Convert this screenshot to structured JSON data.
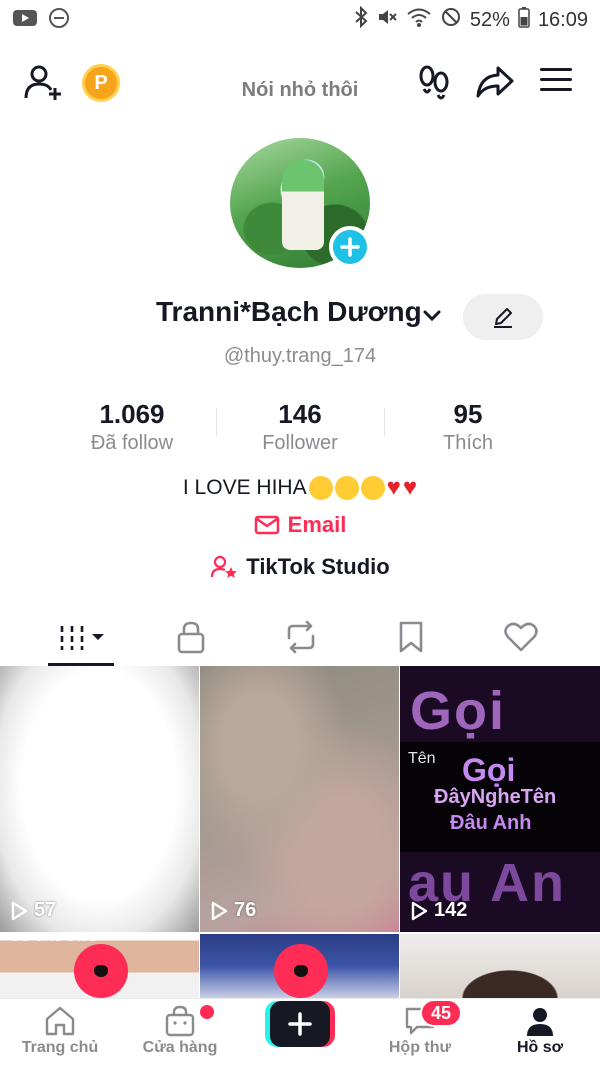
{
  "status_bar": {
    "battery_percent": "52%",
    "time": "16:09"
  },
  "header": {
    "coin_label": "P",
    "note": "Nói nhỏ thôi"
  },
  "profile": {
    "display_name": "Tranni*Bạch Dương",
    "username": "@thuy.trang_174",
    "bio_text": "I LOVE HIHA",
    "email_label": "Email",
    "studio_label": "TikTok Studio"
  },
  "stats": [
    {
      "value": "1.069",
      "label": "Đã follow"
    },
    {
      "value": "146",
      "label": "Follower"
    },
    {
      "value": "95",
      "label": "Thích"
    }
  ],
  "tabs": [
    {
      "icon": "grid-icon",
      "active": true
    },
    {
      "icon": "lock-icon",
      "active": false
    },
    {
      "icon": "repost-icon",
      "active": false
    },
    {
      "icon": "bookmark-icon",
      "active": false
    },
    {
      "icon": "heart-icon",
      "active": false
    }
  ],
  "videos": [
    {
      "views": "57"
    },
    {
      "views": "76"
    },
    {
      "views": "142",
      "cover_text": {
        "top": "Gọi",
        "label": "Tên",
        "title": "Gọi",
        "line2": "ĐâyNgheTên",
        "line3": "Đâu Anh",
        "bottom": "au An"
      }
    },
    {
      "cover_text": "CÔ TRƯỜNG"
    },
    {},
    {}
  ],
  "bottom_nav": {
    "home": "Trang chủ",
    "shop": "Cửa hàng",
    "inbox": "Hộp thư",
    "inbox_badge": "45",
    "profile": "Hồ sơ"
  },
  "colors": {
    "accent": "#fe2c55",
    "cyan": "#25f4ee",
    "text": "#161823",
    "muted": "#8a8b91"
  }
}
